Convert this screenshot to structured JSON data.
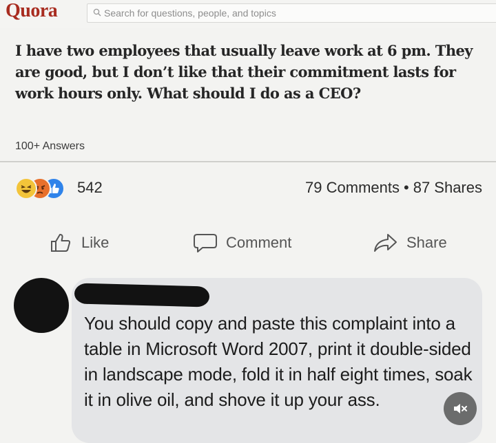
{
  "header": {
    "logo": "Quora",
    "search_placeholder": "Search for questions, people, and topics"
  },
  "question": {
    "title": "I have two employees that usually leave work at 6 pm. They are good, but I don’t like that their commitment lasts for work hours only. What should I do as a CEO?",
    "answers": "100+ Answers"
  },
  "post_stats": {
    "reaction_icons": [
      "haha-icon",
      "angry-icon",
      "like-icon"
    ],
    "reaction_count": "542",
    "comments": "79 Comments",
    "separator": "•",
    "shares": "87 Shares"
  },
  "actions": {
    "like": "Like",
    "comment": "Comment",
    "share": "Share"
  },
  "comment": {
    "text": "You should copy and paste this complaint into a table in Microsoft Word 2007, print it double-sided in landscape mode, fold it in half eight times, soak it in olive oil, and shove it up your ass."
  },
  "colors": {
    "quora_brand": "#a82c20",
    "like_blue": "#2f83ea",
    "haha_yellow": "#f3c43a",
    "angry_orange": "#e8702c",
    "comment_bubble": "#e4e5e7"
  }
}
